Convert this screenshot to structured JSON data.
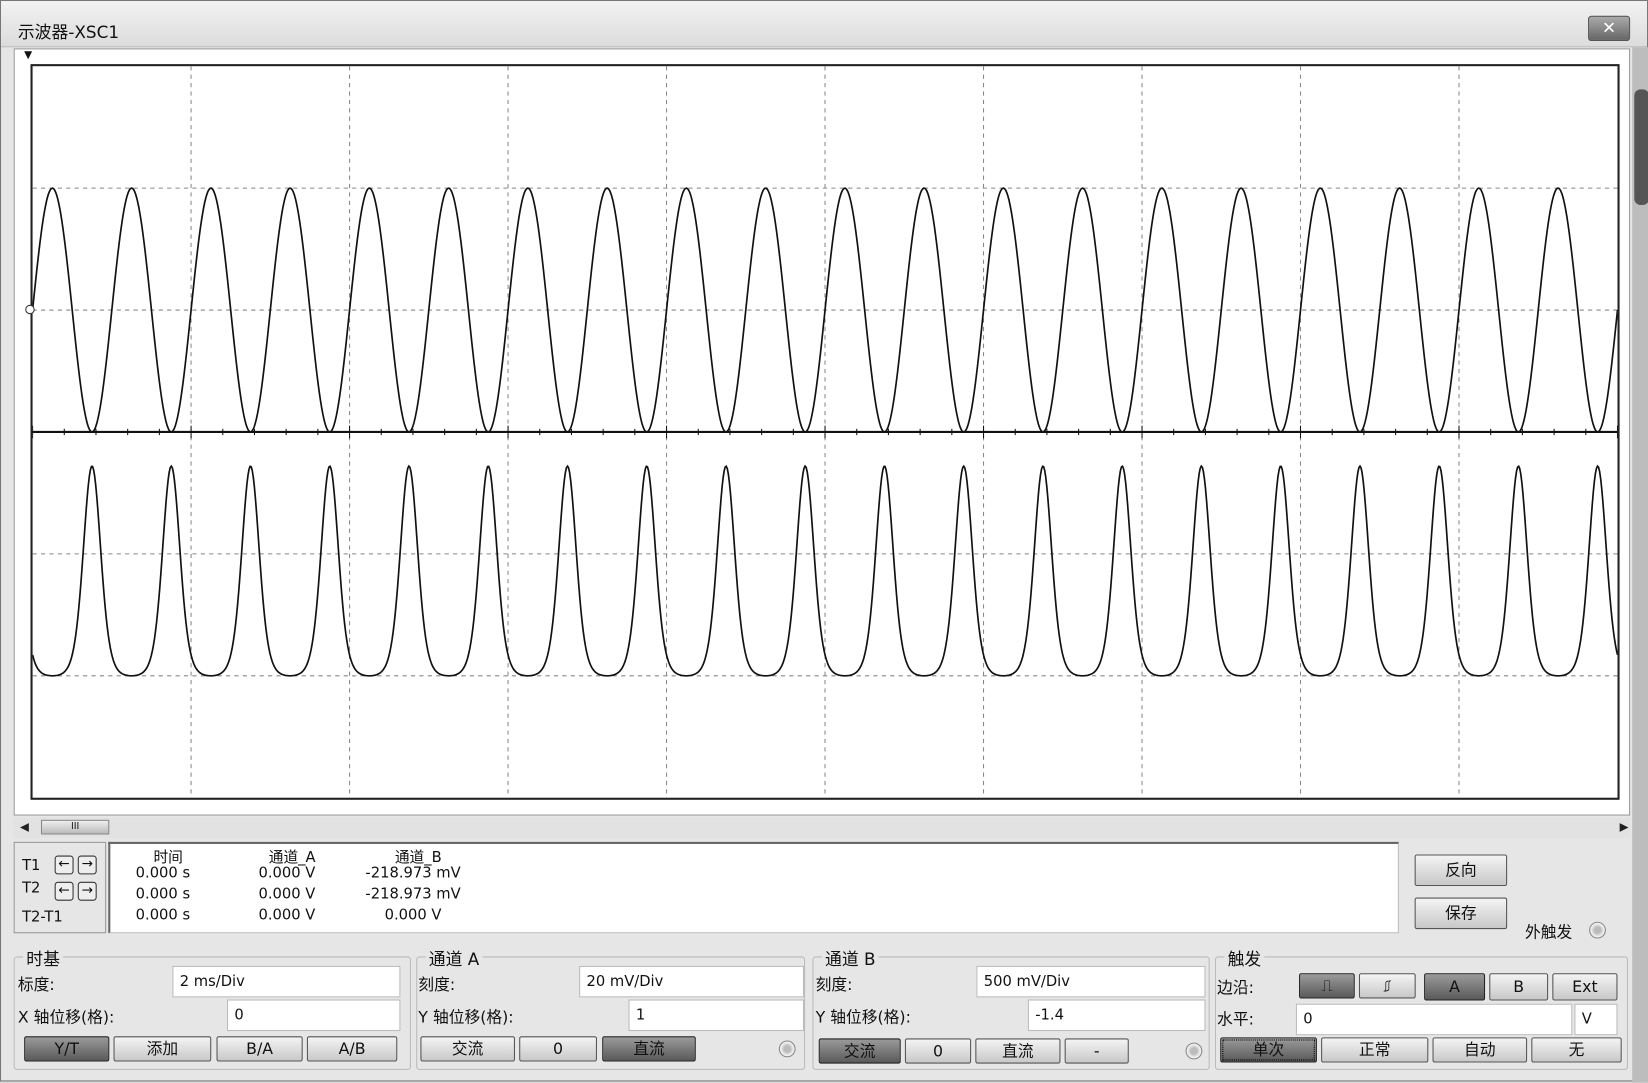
{
  "window": {
    "title": "示波器-XSC1",
    "close_icon": "close-icon"
  },
  "readout": {
    "headers": [
      "时间",
      "通道_A",
      "通道_B"
    ],
    "rows": [
      {
        "label": "T1",
        "time": "0.000 s",
        "a": "0.000 V",
        "b": "-218.973 mV"
      },
      {
        "label": "T2",
        "time": "0.000 s",
        "a": "0.000 V",
        "b": "-218.973 mV"
      },
      {
        "label": "T2-T1",
        "time": "0.000 s",
        "a": "0.000 V",
        "b": "0.000 V"
      }
    ],
    "reverse_label": "反向",
    "save_label": "保存",
    "ext_trigger_label": "外触发"
  },
  "timebase": {
    "title": "时基",
    "scale_label": "标度:",
    "scale": "2 ms/Div",
    "xpos_label": "X 轴位移(格):",
    "xpos": "0",
    "buttons": [
      "Y/T",
      "添加",
      "B/A",
      "A/B"
    ],
    "active": "Y/T"
  },
  "channel_a": {
    "title": "通道 A",
    "scale_label": "刻度:",
    "scale": "20 mV/Div",
    "ypos_label": "Y 轴位移(格):",
    "ypos": "1",
    "buttons": [
      "交流",
      "0",
      "直流"
    ],
    "active": "直流"
  },
  "channel_b": {
    "title": "通道 B",
    "scale_label": "刻度:",
    "scale": "500 mV/Div",
    "ypos_label": "Y 轴位移(格):",
    "ypos": "-1.4",
    "buttons": [
      "交流",
      "0",
      "直流",
      "-"
    ],
    "active": "交流"
  },
  "trigger": {
    "title": "触发",
    "edge_label": "边沿:",
    "edge_buttons": [
      "rising-edge",
      "falling-edge"
    ],
    "source_buttons": [
      "A",
      "B",
      "Ext"
    ],
    "active_source": "A",
    "level_label": "水平:",
    "level": "0",
    "level_unit": "V",
    "mode_buttons": [
      "单次",
      "正常",
      "自动",
      "无"
    ],
    "active_mode": "单次"
  },
  "chart_data": {
    "type": "line",
    "title": "",
    "x_divisions": 10,
    "y_divisions": 6,
    "grid": true,
    "time_per_div_ms": 2,
    "series": [
      {
        "name": "通道_A",
        "shape": "sine",
        "frequency_hz": 1000,
        "amplitude_div": 1,
        "offset_div": 1,
        "phase": "rising-from-zero",
        "color": "#111111"
      },
      {
        "name": "通道_B",
        "shape": "distorted-inverted-sine",
        "frequency_hz": 1000,
        "peak_div": 1.12,
        "trough_div": -0.6,
        "offset_div": -1.4,
        "color": "#111111"
      }
    ],
    "xlim_ms": [
      0,
      20
    ],
    "ylim_div": [
      -3,
      3
    ]
  }
}
